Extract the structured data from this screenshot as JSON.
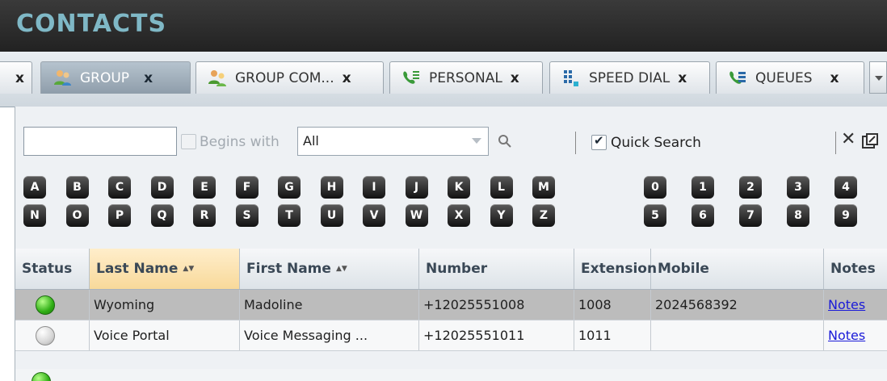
{
  "window": {
    "title": "CONTACTS"
  },
  "tabs": [
    {
      "label": "",
      "close": "x",
      "icon": "",
      "active": false
    },
    {
      "label": "GROUP",
      "close": "x",
      "icon": "group-users-icon",
      "active": true
    },
    {
      "label": "GROUP COM...",
      "close": "x",
      "icon": "group-common-icon",
      "active": false
    },
    {
      "label": "PERSONAL",
      "close": "x",
      "icon": "personal-phone-icon",
      "active": false
    },
    {
      "label": "SPEED DIAL",
      "close": "x",
      "icon": "speed-dial-icon",
      "active": false
    },
    {
      "label": "QUEUES",
      "close": "x",
      "icon": "queues-icon",
      "active": false
    }
  ],
  "search": {
    "value": "",
    "begins_with_label": "Begins with",
    "filter_selected": "All",
    "quick_search_label": "Quick Search",
    "quick_search_checked": true,
    "close_label": "✕"
  },
  "letters_row1": [
    "A",
    "B",
    "C",
    "D",
    "E",
    "F",
    "G",
    "H",
    "I",
    "J",
    "K",
    "L",
    "M"
  ],
  "letters_row2": [
    "N",
    "O",
    "P",
    "Q",
    "R",
    "S",
    "T",
    "U",
    "V",
    "W",
    "X",
    "Y",
    "Z"
  ],
  "digits_row1": [
    "0",
    "1",
    "2",
    "3",
    "4"
  ],
  "digits_row2": [
    "5",
    "6",
    "7",
    "8",
    "9"
  ],
  "table": {
    "columns": [
      "Status",
      "Last Name",
      "First Name",
      "Number",
      "Extension",
      "Mobile",
      "Notes"
    ],
    "sort_indicator": "▲▼",
    "rows": [
      {
        "status": "available",
        "last_name": "Wyoming",
        "first_name": "Madoline",
        "number": "+12025551008",
        "extension": "1008",
        "mobile": "2024568392",
        "notes": "Notes"
      },
      {
        "status": "offline",
        "last_name": "Voice Portal",
        "first_name": "Voice Messaging ...",
        "number": "+12025551011",
        "extension": "1011",
        "mobile": "",
        "notes": "Notes"
      }
    ]
  },
  "colors": {
    "title": "#7fb8c6",
    "available": "#2fae15",
    "link": "#1a1ad8"
  }
}
